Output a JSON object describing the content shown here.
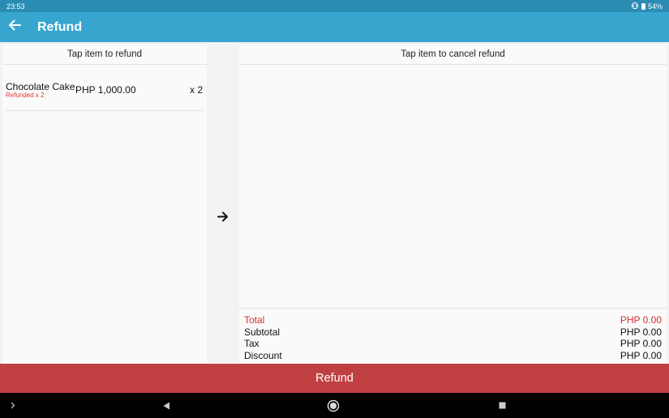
{
  "status_bar": {
    "time": "23:53",
    "battery": "54%",
    "icons": [
      "vibrate-icon",
      "battery-icon"
    ]
  },
  "app_bar": {
    "title": "Refund",
    "back_icon": "arrow-left-icon",
    "color": "#37a6cf"
  },
  "left_panel": {
    "header": "Tap item to refund",
    "items": [
      {
        "name": "Chocolate Cake",
        "refunded": "Refunded x 2",
        "price": "PHP 1,000.00",
        "qty": "x 2"
      }
    ]
  },
  "move_icon": "arrow-right-icon",
  "right_panel": {
    "header": "Tap item to cancel refund",
    "summary": {
      "total_label": "Total",
      "total_value": "PHP 0.00",
      "subtotal_label": "Subtotal",
      "subtotal_value": "PHP 0.00",
      "tax_label": "Tax",
      "tax_value": "PHP 0.00",
      "discount_label": "Discount",
      "discount_value": "PHP 0.00"
    }
  },
  "refund_button": {
    "label": "Refund",
    "color": "#c04042"
  },
  "nav_bar": {
    "icons": [
      "chevron-right-icon",
      "back-triangle-icon",
      "home-circle-icon",
      "recents-square-icon"
    ]
  }
}
